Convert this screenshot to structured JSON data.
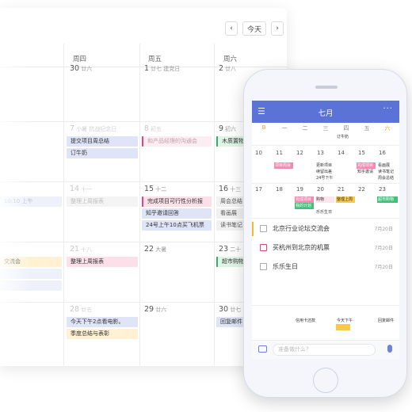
{
  "desktop": {
    "nav": {
      "prev": "‹",
      "today": "今天",
      "next": "›"
    },
    "weekdays": [
      "周四",
      "周五",
      "周六"
    ],
    "rows": [
      {
        "dates": [
          {
            "num": "30",
            "sub": "廿六"
          },
          {
            "num": "1",
            "sub": "廿七 建党日"
          },
          {
            "num": "2",
            "sub": "廿八"
          }
        ]
      },
      {
        "dates": [
          {
            "num": "7",
            "sub": "小暑 抗战纪念日"
          },
          {
            "num": "8",
            "sub": "初五"
          },
          {
            "num": "9",
            "sub": "初六"
          }
        ]
      },
      {
        "dates": [
          {
            "num": "14",
            "sub": "十一"
          },
          {
            "num": "15",
            "sub": "十二"
          },
          {
            "num": "16",
            "sub": "十三"
          }
        ]
      },
      {
        "dates": [
          {
            "num": "21",
            "sub": "十八"
          },
          {
            "num": "22",
            "sub": "大暑"
          },
          {
            "num": "23",
            "sub": "二十"
          }
        ]
      },
      {
        "dates": [
          {
            "num": "28",
            "sub": "廿五"
          },
          {
            "num": "29",
            "sub": "廿六"
          },
          {
            "num": "30",
            "sub": "廿七"
          }
        ]
      }
    ],
    "events": {
      "r2c1a": "提交项目周总结",
      "r2c1b": "订牛奶",
      "r2c2a": "和产品经理的沟通会",
      "r2c3a": "木质置物架",
      "r3c0": "10:10 上午",
      "r3c1a": "整理上周报表",
      "r3c2a": "完成项目可行性分析报",
      "r3c2b": "知乎邀请回答",
      "r3c2c": "24号上午10点买飞机票",
      "r3c3a": "周会总结",
      "r3c3b": "看画展",
      "r3c3c": "读书笔记",
      "r4c0a": "交流会",
      "r4c1a": "整理上周报表",
      "r4c3a": "超市购物",
      "r5c1a": "今天下午2点看电影。",
      "r5c1b": "季度总结与表彰",
      "r5c3a": "回复邮件"
    }
  },
  "phone": {
    "title": "七月",
    "menu_icon": "☰",
    "more_icon": "···",
    "weekdays": [
      "B",
      "一",
      "二",
      "三",
      "四",
      "五",
      "六"
    ],
    "row0_events": [
      "订牛奶"
    ],
    "row1": [
      "10",
      "11",
      "12",
      "13",
      "14",
      "15",
      "16"
    ],
    "row1_events": [
      "项目周会",
      "更新项目",
      "续留出差",
      "24号下午",
      "完成项目",
      "知乎邀请",
      "看画展",
      "读书笔记",
      "周会总结"
    ],
    "row2": [
      "17",
      "18",
      "19",
      "20",
      "21",
      "22",
      "23"
    ],
    "row2_events": [
      "完成项目",
      "我的计划",
      "购物",
      "乐乐生日",
      "整理上周",
      "超市购物"
    ],
    "todos": [
      {
        "text": "北京行业论坛交流会",
        "date": "7月20日"
      },
      {
        "text": "买杭州到北京的机票",
        "date": "7月20日"
      },
      {
        "text": "乐乐生日",
        "date": "7月20日"
      }
    ],
    "row3_events": [
      "信用卡还款",
      "今天下午",
      "回复邮件"
    ],
    "input_placeholder": "准备做什么？"
  }
}
